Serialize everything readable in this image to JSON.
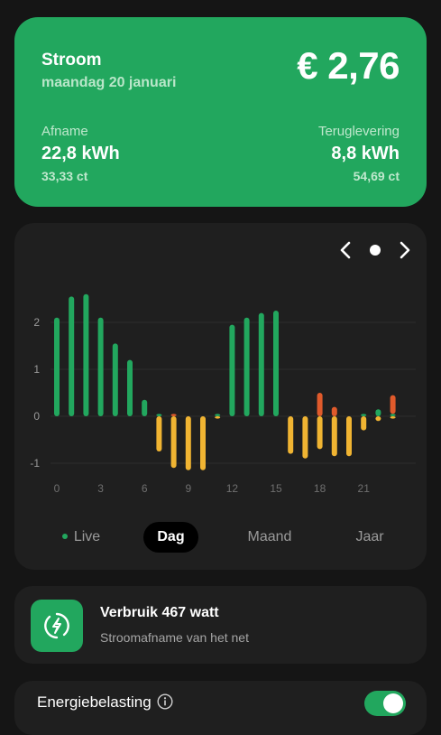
{
  "summary": {
    "title": "Stroom",
    "date": "maandag 20 januari",
    "amount": "€ 2,76",
    "afname": {
      "label": "Afname",
      "value": "22,8 kWh",
      "price": "33,33 ct"
    },
    "teruglevering": {
      "label": "Teruglevering",
      "value": "8,8 kWh",
      "price": "54,69 ct"
    },
    "color": "#22a75e"
  },
  "chart_nav": {
    "prev_icon": "chevron-left-icon",
    "current_icon": "dot-icon",
    "next_icon": "chevron-right-icon"
  },
  "chart_data": {
    "type": "bar",
    "x": [
      0,
      1,
      2,
      3,
      4,
      5,
      6,
      7,
      8,
      9,
      10,
      11,
      12,
      13,
      14,
      15,
      16,
      17,
      18,
      19,
      20,
      21,
      22,
      23
    ],
    "xtick_labels": [
      "0",
      "3",
      "6",
      "9",
      "12",
      "15",
      "18",
      "21"
    ],
    "xticks": [
      0,
      3,
      6,
      9,
      12,
      15,
      18,
      21
    ],
    "yticks": [
      -1,
      0,
      1,
      2
    ],
    "ylim": [
      -1.2,
      2.9
    ],
    "grid": true,
    "series": [
      {
        "color": "#22a75e",
        "values": [
          2.1,
          2.55,
          2.6,
          2.1,
          1.55,
          1.2,
          0.35,
          0.05,
          0,
          0,
          0,
          0.05,
          1.95,
          2.1,
          2.2,
          2.25,
          0,
          0,
          0,
          0,
          0,
          0.05,
          0.15,
          0.05
        ]
      },
      {
        "color": "#e05a2b",
        "values": [
          0,
          0,
          0,
          0,
          0,
          0,
          0,
          0,
          0.05,
          0,
          0,
          0,
          0,
          0,
          0,
          0,
          0,
          0,
          0.5,
          0.2,
          0,
          0,
          0,
          0.4
        ]
      },
      {
        "color": "#f0b432",
        "values": [
          0,
          0,
          0,
          0,
          0,
          0,
          0,
          -0.75,
          -1.1,
          -1.15,
          -1.15,
          -0.05,
          0,
          0,
          0,
          0,
          -0.8,
          -0.9,
          -0.7,
          -0.85,
          -0.85,
          -0.3,
          -0.1,
          -0.05
        ]
      }
    ]
  },
  "tabs": {
    "live": "Live",
    "dag": "Dag",
    "maand": "Maand",
    "jaar": "Jaar"
  },
  "usage": {
    "icon": "lightning-icon",
    "title": "Verbruik 467 watt",
    "subtitle": "Stroomafname van het net"
  },
  "tax": {
    "label": "Energiebelasting",
    "info_icon": "info-icon",
    "enabled": true
  }
}
